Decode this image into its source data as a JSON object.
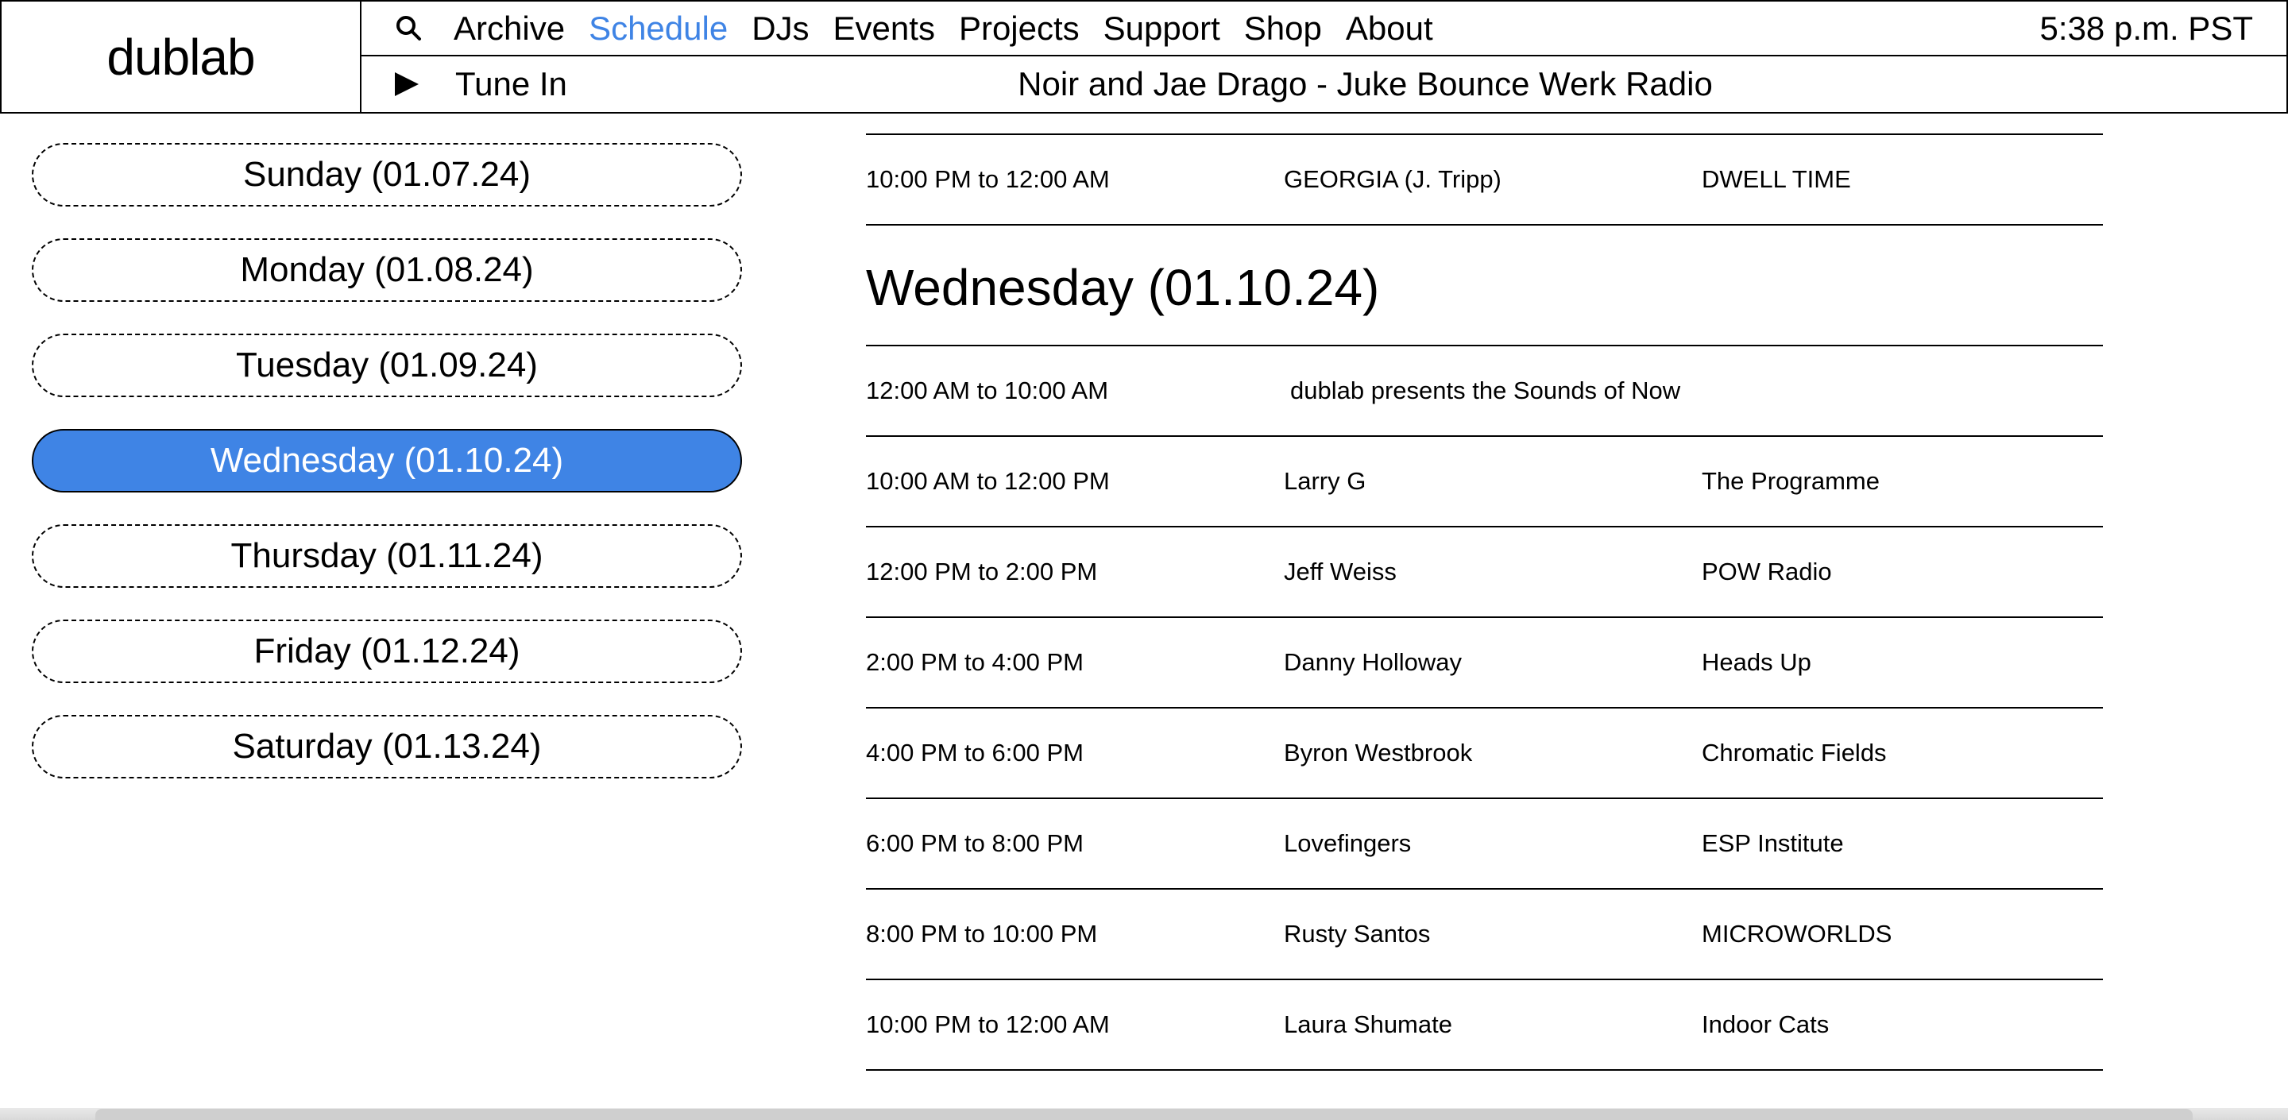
{
  "header": {
    "logo": "dublab",
    "nav": [
      "Archive",
      "Schedule",
      "DJs",
      "Events",
      "Projects",
      "Support",
      "Shop",
      "About"
    ],
    "active_nav": "Schedule",
    "clock": "5:38 p.m. PST",
    "tune_in_label": "Tune In",
    "now_playing": "Noir and Jae Drago - Juke Bounce Werk Radio",
    "accent_color": "#3f84e5"
  },
  "days": [
    "Sunday (01.07.24)",
    "Monday (01.08.24)",
    "Tuesday (01.09.24)",
    "Wednesday (01.10.24)",
    "Thursday (01.11.24)",
    "Friday (01.12.24)",
    "Saturday (01.13.24)"
  ],
  "selected_day": "Wednesday (01.10.24)",
  "schedule": {
    "previous_day_last_slot": {
      "time": "10:00 PM to 12:00 AM",
      "dj": "GEORGIA (J. Tripp)",
      "show": "DWELL TIME"
    },
    "day_heading": "Wednesday (01.10.24)",
    "first_slot": {
      "time": "12:00 AM to 10:00 AM",
      "title": "dublab presents the Sounds of Now"
    },
    "slots": [
      {
        "time": "10:00 AM to 12:00 PM",
        "dj": "Larry G",
        "show": "The Programme"
      },
      {
        "time": "12:00 PM to 2:00 PM",
        "dj": "Jeff Weiss",
        "show": "POW Radio"
      },
      {
        "time": "2:00 PM to 4:00 PM",
        "dj": "Danny Holloway",
        "show": "Heads Up"
      },
      {
        "time": "4:00 PM to 6:00 PM",
        "dj": "Byron Westbrook",
        "show": "Chromatic Fields"
      },
      {
        "time": "6:00 PM to 8:00 PM",
        "dj": "Lovefingers",
        "show": "ESP Institute"
      },
      {
        "time": "8:00 PM to 10:00 PM",
        "dj": "Rusty Santos",
        "show": "MICROWORLDS"
      },
      {
        "time": "10:00 PM to 12:00 AM",
        "dj": "Laura Shumate",
        "show": "Indoor Cats"
      }
    ]
  }
}
